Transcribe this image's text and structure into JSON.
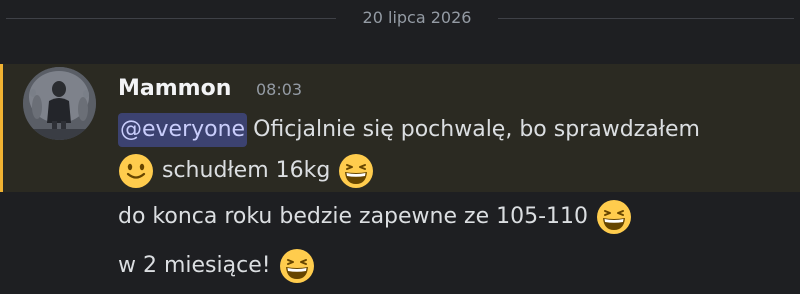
{
  "divider": {
    "date": "20 lipca 2026"
  },
  "message": {
    "author": "Mammon",
    "time": "08:03",
    "highlight_color": "#f0b232",
    "mention": "@everyone",
    "line1_text": "Oficjalnie się pochwalę, bo sprawdzałem",
    "line2_text": "schudłem 16kg",
    "line3_text": "do konca roku bedzie zapewne ze 105-110",
    "line4_text": "w 2 miesiące!",
    "emojis": [
      "slightly-smiling-face-icon",
      "grinning-squinting-face-icon"
    ]
  }
}
